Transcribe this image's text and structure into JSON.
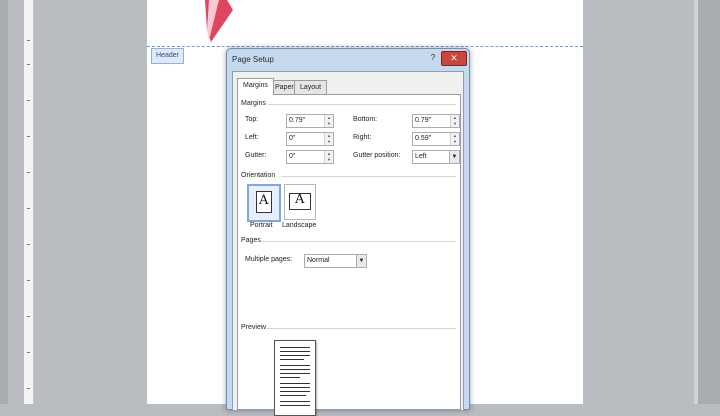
{
  "document": {
    "header_tab": "Header"
  },
  "dialog": {
    "title": "Page Setup",
    "help_symbol": "?",
    "close_symbol": "✕",
    "tabs": [
      {
        "label": "Margins",
        "active": true
      },
      {
        "label": "Paper",
        "active": false
      },
      {
        "label": "Layout",
        "active": false
      }
    ],
    "margins": {
      "section": "Margins",
      "top": {
        "label": "Top:",
        "value": "0.79\""
      },
      "bottom": {
        "label": "Bottom:",
        "value": "0.79\""
      },
      "left": {
        "label": "Left:",
        "value": "0\""
      },
      "right": {
        "label": "Right:",
        "value": "0.59\""
      },
      "gutter": {
        "label": "Gutter:",
        "value": "0\""
      },
      "gutter_position": {
        "label": "Gutter position:",
        "value": "Left"
      }
    },
    "orientation": {
      "section": "Orientation",
      "portrait": {
        "label": "Portrait",
        "glyph": "A",
        "selected": true
      },
      "landscape": {
        "label": "Landscape",
        "glyph": "A",
        "selected": false
      }
    },
    "pages": {
      "section": "Pages",
      "multiple_pages": {
        "label": "Multiple pages:",
        "value": "Normal"
      }
    },
    "preview": {
      "section": "Preview"
    }
  },
  "colors": {
    "logo_accent": "#e0455f",
    "close_button": "#c9463d",
    "selection": "#7ea7dc"
  }
}
